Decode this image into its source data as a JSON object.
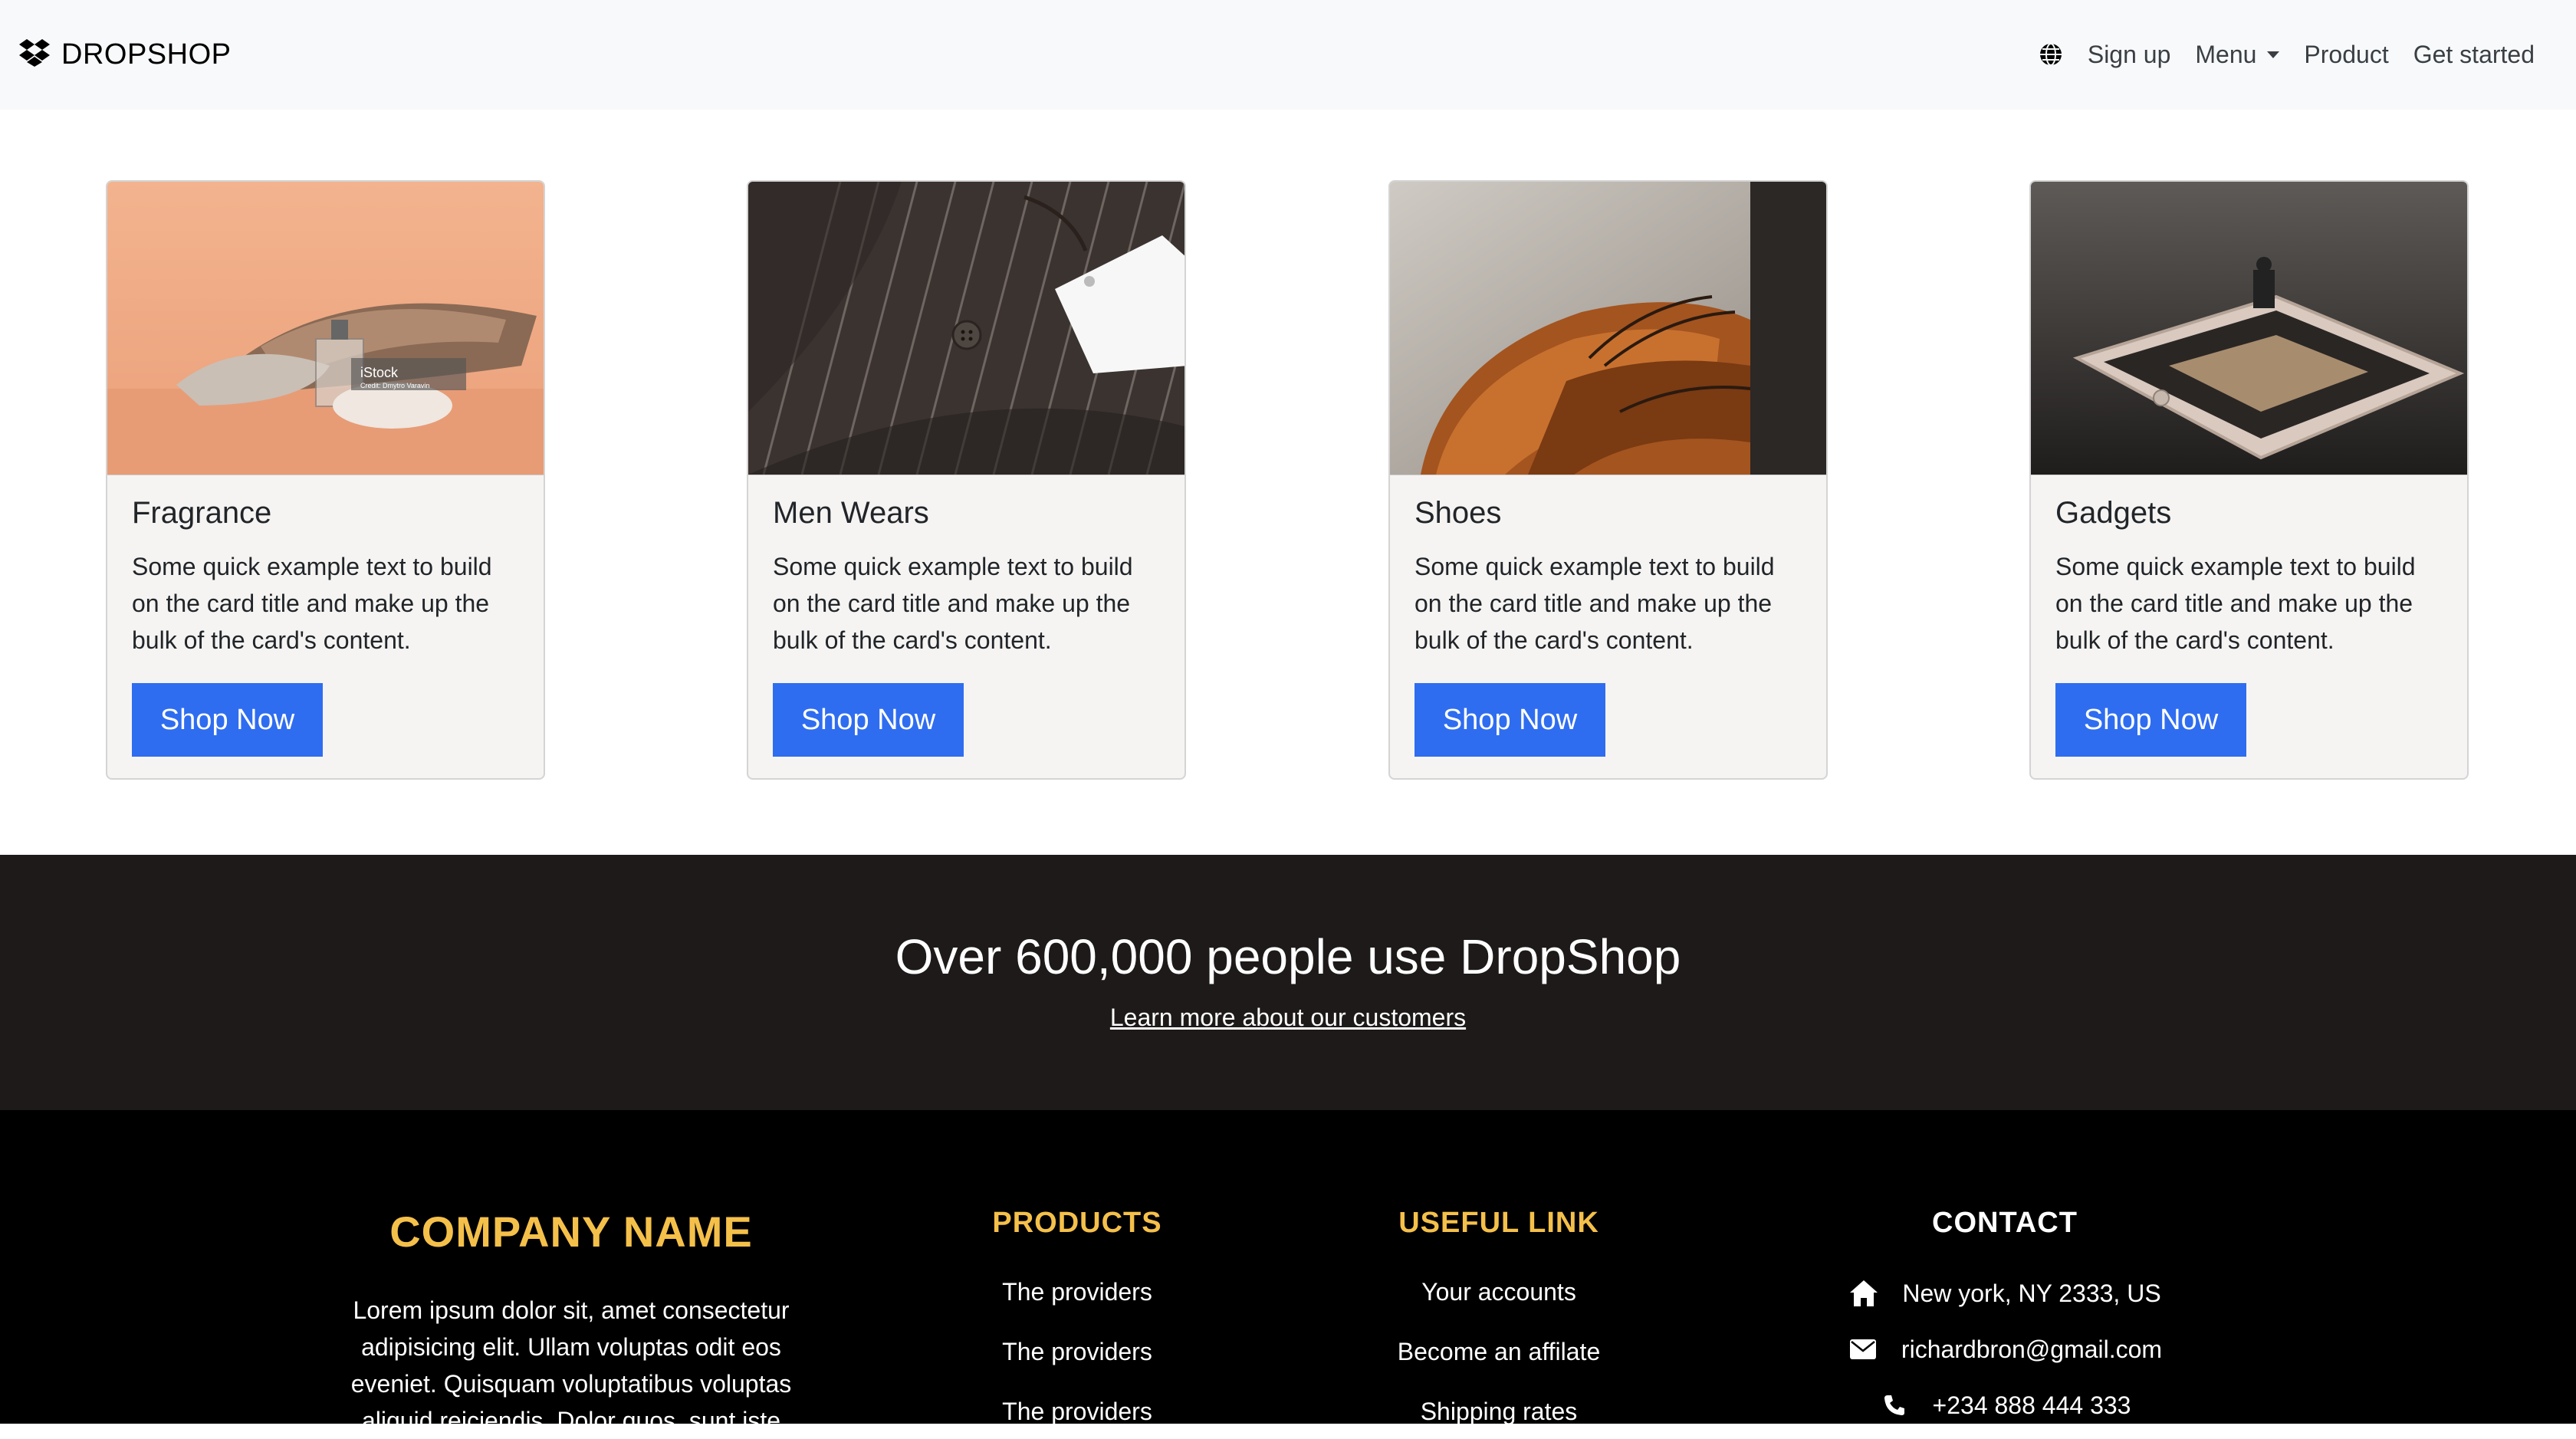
{
  "navbar": {
    "brand": "DROPSHOP",
    "links": {
      "signup": "Sign up",
      "menu": "Menu",
      "product": "Product",
      "get_started": "Get started"
    }
  },
  "cards": [
    {
      "title": "Fragrance",
      "text": "Some quick example text to build on the card title and make up the bulk of the card's content.",
      "button": "Shop Now",
      "watermark": "iStock",
      "watermark_credit": "Credit: Dmytro Varavin"
    },
    {
      "title": "Men Wears",
      "text": "Some quick example text to build on the card title and make up the bulk of the card's content.",
      "button": "Shop Now"
    },
    {
      "title": "Shoes",
      "text": "Some quick example text to build on the card title and make up the bulk of the card's content.",
      "button": "Shop Now"
    },
    {
      "title": "Gadgets",
      "text": "Some quick example text to build on the card title and make up the bulk of the card's content.",
      "button": "Shop Now"
    }
  ],
  "stats": {
    "title": "Over 600,000 people use DropShop",
    "link": "Learn more about our customers"
  },
  "footer": {
    "company_name": "COMPANY NAME",
    "about": "Lorem ipsum dolor sit, amet consectetur adipisicing elit. Ullam voluptas odit eos eveniet. Quisquam voluptatibus voluptas aliquid reiciendis. Dolor quos, sunt iste",
    "products": {
      "heading": "PRODUCTS",
      "links": [
        "The providers",
        "The providers",
        "The providers"
      ]
    },
    "useful": {
      "heading": "USEFUL LINK",
      "links": [
        "Your accounts",
        "Become an affilate",
        "Shipping rates"
      ]
    },
    "contact": {
      "heading": "CONTACT",
      "address": "New york, NY 2333, US",
      "email": "richardbron@gmail.com",
      "phone": "+234 888 444 333"
    }
  },
  "colors": {
    "accent_blue": "#2f6df0",
    "footer_gold": "#f5c04a",
    "dark_band": "#1e1a19"
  },
  "icons": {
    "brand": "dropbox-icon",
    "globe": "globe-icon",
    "home": "home-icon",
    "email": "envelope-icon",
    "phone": "phone-icon"
  }
}
